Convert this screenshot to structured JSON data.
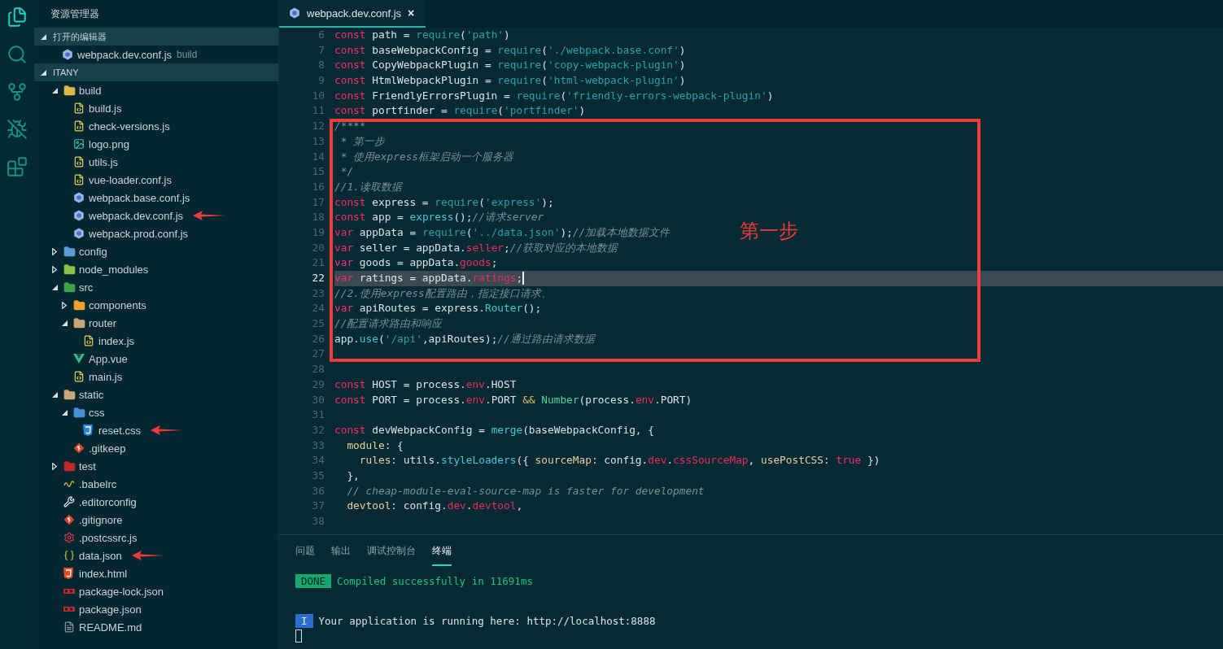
{
  "activity_bar": [
    {
      "kind": "files",
      "selected": true
    },
    {
      "kind": "search",
      "selected": false
    },
    {
      "kind": "scm",
      "selected": false
    },
    {
      "kind": "debug",
      "selected": false
    },
    {
      "kind": "extensions",
      "selected": false
    }
  ],
  "sidebar": {
    "title": "资源管理器",
    "open_editors": {
      "title": "打开的编辑器",
      "expanded": true,
      "items": [
        {
          "name": "webpack.dev.conf.js",
          "folder": "build",
          "kind": "webpack"
        }
      ]
    },
    "project": {
      "title": "ITANY",
      "expanded": true,
      "tree": [
        {
          "name": "build",
          "kind": "folder",
          "color": "#e0b84a",
          "expanded": true,
          "children": [
            {
              "name": "build.js",
              "kind": "js"
            },
            {
              "name": "check-versions.js",
              "kind": "js"
            },
            {
              "name": "logo.png",
              "kind": "image"
            },
            {
              "name": "utils.js",
              "kind": "js"
            },
            {
              "name": "vue-loader.conf.js",
              "kind": "js"
            },
            {
              "name": "webpack.base.conf.js",
              "kind": "webpack"
            },
            {
              "name": "webpack.dev.conf.js",
              "kind": "webpack",
              "pointer": true
            },
            {
              "name": "webpack.prod.conf.js",
              "kind": "webpack"
            }
          ]
        },
        {
          "name": "config",
          "kind": "folder",
          "color": "#5b9bd5",
          "expanded": false
        },
        {
          "name": "node_modules",
          "kind": "folder",
          "color": "#8bc34a",
          "expanded": false
        },
        {
          "name": "src",
          "kind": "folder",
          "color": "#3fa34d",
          "expanded": true,
          "children": [
            {
              "name": "components",
              "kind": "folder",
              "color": "#f0a030",
              "expanded": false
            },
            {
              "name": "router",
              "kind": "folder",
              "color": "#c8a878",
              "expanded": true,
              "children": [
                {
                  "name": "index.js",
                  "kind": "js"
                }
              ]
            },
            {
              "name": "App.vue",
              "kind": "vue"
            },
            {
              "name": "main.js",
              "kind": "js"
            }
          ]
        },
        {
          "name": "static",
          "kind": "folder",
          "color": "#c8a878",
          "expanded": true,
          "children": [
            {
              "name": "css",
              "kind": "folder",
              "color": "#4a90d9",
              "expanded": true,
              "children": [
                {
                  "name": "reset.css",
                  "kind": "css",
                  "pointer": true
                }
              ]
            },
            {
              "name": ".gitkeep",
              "kind": "git"
            }
          ]
        },
        {
          "name": "test",
          "kind": "folder",
          "color": "#c0282a",
          "expanded": false
        },
        {
          "name": ".babelrc",
          "kind": "babel"
        },
        {
          "name": ".editorconfig",
          "kind": "editorconfig"
        },
        {
          "name": ".gitignore",
          "kind": "git"
        },
        {
          "name": ".postcssrc.js",
          "kind": "postcss"
        },
        {
          "name": "data.json",
          "kind": "json",
          "pointer": true
        },
        {
          "name": "index.html",
          "kind": "html"
        },
        {
          "name": "package-lock.json",
          "kind": "npm"
        },
        {
          "name": "package.json",
          "kind": "npm"
        },
        {
          "name": "README.md",
          "kind": "md"
        }
      ]
    }
  },
  "editor": {
    "tabs": [
      {
        "label": "webpack.dev.conf.js",
        "kind": "webpack",
        "selected": true,
        "close": "×"
      }
    ],
    "lines": [
      {
        "number": "6",
        "current": false,
        "tokens": [
          {
            "text": "const",
            "kind": "kw"
          },
          {
            "text": " path = ",
            "kind": "id"
          },
          {
            "text": "require",
            "kind": "fn"
          },
          {
            "text": "(",
            "kind": "id"
          },
          {
            "text": "'path'",
            "kind": "str"
          },
          {
            "text": ")",
            "kind": "id"
          }
        ]
      },
      {
        "number": "7",
        "current": false,
        "tokens": [
          {
            "text": "const",
            "kind": "kw"
          },
          {
            "text": " baseWebpackConfig = ",
            "kind": "id"
          },
          {
            "text": "require",
            "kind": "fn"
          },
          {
            "text": "(",
            "kind": "id"
          },
          {
            "text": "'./webpack.base.conf'",
            "kind": "str"
          },
          {
            "text": ")",
            "kind": "id"
          }
        ]
      },
      {
        "number": "8",
        "current": false,
        "tokens": [
          {
            "text": "const",
            "kind": "kw"
          },
          {
            "text": " CopyWebpackPlugin = ",
            "kind": "id"
          },
          {
            "text": "require",
            "kind": "fn"
          },
          {
            "text": "(",
            "kind": "id"
          },
          {
            "text": "'copy-webpack-plugin'",
            "kind": "str"
          },
          {
            "text": ")",
            "kind": "id"
          }
        ]
      },
      {
        "number": "9",
        "current": false,
        "tokens": [
          {
            "text": "const",
            "kind": "kw"
          },
          {
            "text": " HtmlWebpackPlugin = ",
            "kind": "id"
          },
          {
            "text": "require",
            "kind": "fn"
          },
          {
            "text": "(",
            "kind": "id"
          },
          {
            "text": "'html-webpack-plugin'",
            "kind": "str"
          },
          {
            "text": ")",
            "kind": "id"
          }
        ]
      },
      {
        "number": "10",
        "current": false,
        "tokens": [
          {
            "text": "const",
            "kind": "kw"
          },
          {
            "text": " FriendlyErrorsPlugin = ",
            "kind": "id"
          },
          {
            "text": "require",
            "kind": "fn"
          },
          {
            "text": "(",
            "kind": "id"
          },
          {
            "text": "'friendly-errors-webpack-plugin'",
            "kind": "str"
          },
          {
            "text": ")",
            "kind": "id"
          }
        ]
      },
      {
        "number": "11",
        "current": false,
        "tokens": [
          {
            "text": "const",
            "kind": "kw"
          },
          {
            "text": " portfinder = ",
            "kind": "id"
          },
          {
            "text": "require",
            "kind": "fn"
          },
          {
            "text": "(",
            "kind": "id"
          },
          {
            "text": "'portfinder'",
            "kind": "str"
          },
          {
            "text": ")",
            "kind": "id"
          }
        ]
      }
    ],
    "annotated": {
      "label": "第一步",
      "lines": [
        {
          "number": "12",
          "current": false,
          "tokens": [
            {
              "text": "/****",
              "kind": "cm"
            }
          ]
        },
        {
          "number": "13",
          "current": false,
          "tokens": [
            {
              "text": " * 第一步",
              "kind": "cm"
            }
          ]
        },
        {
          "number": "14",
          "current": false,
          "tokens": [
            {
              "text": " * 使用express框架启动一个服务器",
              "kind": "cm"
            }
          ]
        },
        {
          "number": "15",
          "current": false,
          "tokens": [
            {
              "text": " */",
              "kind": "cm"
            }
          ]
        },
        {
          "number": "16",
          "current": false,
          "tokens": [
            {
              "text": "//1.读取数据",
              "kind": "cm"
            }
          ]
        },
        {
          "number": "17",
          "current": false,
          "tokens": [
            {
              "text": "const",
              "kind": "kw"
            },
            {
              "text": " express = ",
              "kind": "id"
            },
            {
              "text": "require",
              "kind": "fn"
            },
            {
              "text": "(",
              "kind": "id"
            },
            {
              "text": "'express'",
              "kind": "str"
            },
            {
              "text": ");",
              "kind": "id"
            }
          ]
        },
        {
          "number": "18",
          "current": false,
          "tokens": [
            {
              "text": "const",
              "kind": "kw"
            },
            {
              "text": " app = ",
              "kind": "id"
            },
            {
              "text": "express",
              "kind": "call"
            },
            {
              "text": "();",
              "kind": "id"
            },
            {
              "text": "//请求server",
              "kind": "cm"
            }
          ]
        },
        {
          "number": "19",
          "current": false,
          "tokens": [
            {
              "text": "var",
              "kind": "kw"
            },
            {
              "text": " appData = ",
              "kind": "id"
            },
            {
              "text": "require",
              "kind": "fn"
            },
            {
              "text": "(",
              "kind": "id"
            },
            {
              "text": "'../data.json'",
              "kind": "str"
            },
            {
              "text": ");",
              "kind": "id"
            },
            {
              "text": "//加载本地数据文件",
              "kind": "cm"
            }
          ]
        },
        {
          "number": "20",
          "current": false,
          "tokens": [
            {
              "text": "var",
              "kind": "kw"
            },
            {
              "text": " seller = appData.",
              "kind": "id"
            },
            {
              "text": "seller",
              "kind": "prop"
            },
            {
              "text": ";",
              "kind": "id"
            },
            {
              "text": "//获取对应的本地数据",
              "kind": "cm"
            }
          ]
        },
        {
          "number": "21",
          "current": false,
          "tokens": [
            {
              "text": "var",
              "kind": "kw"
            },
            {
              "text": " goods = appData.",
              "kind": "id"
            },
            {
              "text": "goods",
              "kind": "prop"
            },
            {
              "text": ";",
              "kind": "id"
            }
          ]
        },
        {
          "number": "22",
          "current": true,
          "tokens": [
            {
              "text": "var",
              "kind": "kw"
            },
            {
              "text": " ratings = appData.",
              "kind": "id"
            },
            {
              "text": "ratings",
              "kind": "prop"
            },
            {
              "text": ";",
              "kind": "id"
            }
          ]
        },
        {
          "number": "23",
          "current": false,
          "tokens": [
            {
              "text": "//2.使用express配置路由，指定接口请求、",
              "kind": "cm"
            }
          ]
        },
        {
          "number": "24",
          "current": false,
          "tokens": [
            {
              "text": "var",
              "kind": "kw"
            },
            {
              "text": " apiRoutes = express.",
              "kind": "id"
            },
            {
              "text": "Router",
              "kind": "call"
            },
            {
              "text": "();",
              "kind": "id"
            }
          ]
        },
        {
          "number": "25",
          "current": false,
          "tokens": [
            {
              "text": "//配置请求路由和响应",
              "kind": "cm"
            }
          ]
        },
        {
          "number": "26",
          "current": false,
          "tokens": [
            {
              "text": "app.",
              "kind": "id"
            },
            {
              "text": "use",
              "kind": "call"
            },
            {
              "text": "(",
              "kind": "id"
            },
            {
              "text": "'/api'",
              "kind": "str"
            },
            {
              "text": ",apiRoutes);",
              "kind": "id"
            },
            {
              "text": "//通过路由请求数据",
              "kind": "cm"
            }
          ]
        },
        {
          "number": "27",
          "current": false
        }
      ]
    },
    "lines_below": [
      {
        "number": "28",
        "current": false
      },
      {
        "number": "29",
        "current": false,
        "tokens": [
          {
            "text": "const",
            "kind": "kw"
          },
          {
            "text": " HOST = process.",
            "kind": "id"
          },
          {
            "text": "env",
            "kind": "prop"
          },
          {
            "text": ".HOST",
            "kind": "id"
          }
        ]
      },
      {
        "number": "30",
        "current": false,
        "tokens": [
          {
            "text": "const",
            "kind": "kw"
          },
          {
            "text": " PORT = process.",
            "kind": "id"
          },
          {
            "text": "env",
            "kind": "prop"
          },
          {
            "text": ".PORT ",
            "kind": "id"
          },
          {
            "text": "&&",
            "kind": "op"
          },
          {
            "text": " Number",
            "kind": "cls"
          },
          {
            "text": "(process.",
            "kind": "id"
          },
          {
            "text": "env",
            "kind": "prop"
          },
          {
            "text": ".PORT)",
            "kind": "id"
          }
        ]
      },
      {
        "number": "31",
        "current": false
      },
      {
        "number": "32",
        "current": false,
        "tokens": [
          {
            "text": "const",
            "kind": "kw"
          },
          {
            "text": " devWebpackConfig = ",
            "kind": "id"
          },
          {
            "text": "merge",
            "kind": "call"
          },
          {
            "text": "(baseWebpackConfig, {",
            "kind": "id"
          }
        ]
      },
      {
        "number": "33",
        "current": false,
        "tokens": [
          {
            "text": "  module",
            "kind": "key"
          },
          {
            "text": ": {",
            "kind": "id"
          }
        ]
      },
      {
        "number": "34",
        "current": false,
        "tokens": [
          {
            "text": "    rules",
            "kind": "key"
          },
          {
            "text": ": utils.",
            "kind": "id"
          },
          {
            "text": "styleLoaders",
            "kind": "call"
          },
          {
            "text": "({ ",
            "kind": "id"
          },
          {
            "text": "sourceMap",
            "kind": "key"
          },
          {
            "text": ": config.",
            "kind": "id"
          },
          {
            "text": "dev",
            "kind": "prop"
          },
          {
            "text": ".",
            "kind": "id"
          },
          {
            "text": "cssSourceMap",
            "kind": "prop"
          },
          {
            "text": ", ",
            "kind": "id"
          },
          {
            "text": "usePostCSS",
            "kind": "key"
          },
          {
            "text": ": ",
            "kind": "id"
          },
          {
            "text": "true",
            "kind": "kw"
          },
          {
            "text": " })",
            "kind": "id"
          }
        ]
      },
      {
        "number": "35",
        "current": false,
        "tokens": [
          {
            "text": "  },",
            "kind": "id"
          }
        ]
      },
      {
        "number": "36",
        "current": false,
        "tokens": [
          {
            "text": "  // cheap-module-eval-source-map is faster for development",
            "kind": "cm"
          }
        ]
      },
      {
        "number": "37",
        "current": false,
        "tokens": [
          {
            "text": "  devtool",
            "kind": "key"
          },
          {
            "text": ": config.",
            "kind": "id"
          },
          {
            "text": "dev",
            "kind": "prop"
          },
          {
            "text": ".",
            "kind": "id"
          },
          {
            "text": "devtool",
            "kind": "prop"
          },
          {
            "text": ",",
            "kind": "id"
          }
        ]
      },
      {
        "number": "38",
        "current": false
      }
    ]
  },
  "panel": {
    "tabs": [
      {
        "label": "问题",
        "selected": false
      },
      {
        "label": "输出",
        "selected": false
      },
      {
        "label": "调试控制台",
        "selected": false
      },
      {
        "label": "终端",
        "selected": true
      }
    ],
    "terminal": [
      {
        "kind": "success",
        "badge": "DONE",
        "text": "Compiled successfully in 11691ms"
      },
      {
        "kind": "info",
        "badge": "I",
        "text": "Your application is running here: http://localhost:8888"
      }
    ]
  }
}
